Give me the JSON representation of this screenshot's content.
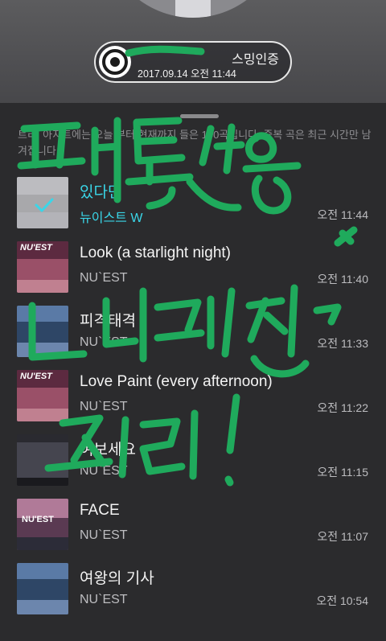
{
  "header": {
    "cert_title": "스밍인증",
    "cert_date": "2017.09.14 오전 11:44"
  },
  "notice": "트리, 아지트에는 오늘 부터 현재까지 들은 100곡입니다. 중복 곡은 최근 시간만 남겨집니다.",
  "tracks": [
    {
      "title": "있다면",
      "artist": "뉴이스트 W",
      "time": "오전 11:44",
      "selected": true
    },
    {
      "title": "Look (a starlight night)",
      "artist": "NU`EST",
      "time": "오전 11:40"
    },
    {
      "title": "피격태격",
      "artist": "NU`EST",
      "time": "오전 11:33"
    },
    {
      "title": "Love Paint (every afternoon)",
      "artist": "NU`EST",
      "time": "오전 11:22"
    },
    {
      "title": "여보세요",
      "artist": "NU`EST",
      "time": "오전 11:15"
    },
    {
      "title": "FACE",
      "artist": "NU`EST",
      "time": "오전 11:07"
    },
    {
      "title": "여왕의 기사",
      "artist": "NU`EST",
      "time": "오전 10:54"
    }
  ],
  "album_art_labels": [
    "NU'EST",
    "NU'EST",
    "NU'EST"
  ],
  "colors": {
    "background": "#2b2b2d",
    "selected_text": "#3ad6e8",
    "graffiti": "#1faa5c"
  },
  "icons": {
    "cert": "record-disc-icon",
    "selected": "checkmark-icon"
  }
}
